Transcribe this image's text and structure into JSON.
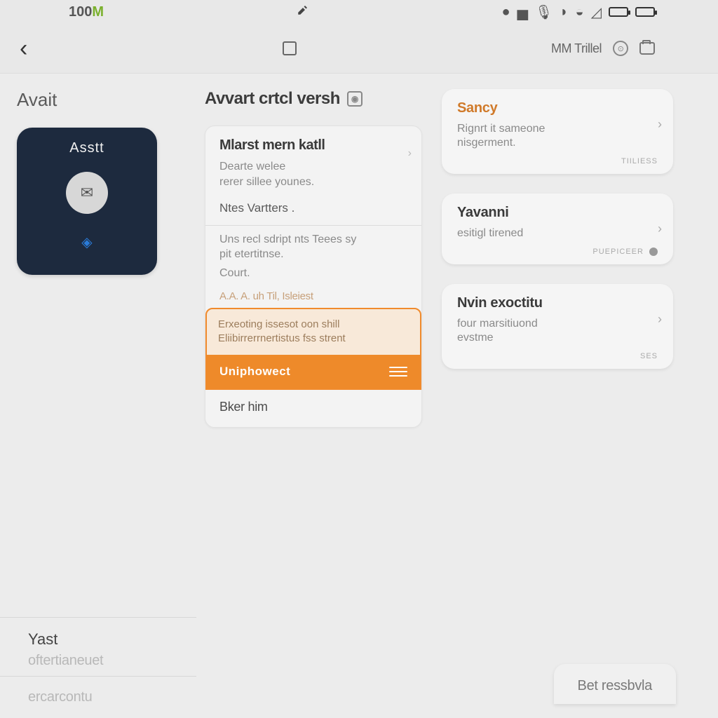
{
  "statusbar": {
    "time_prefix": "100",
    "time_suffix": "M"
  },
  "titlebar": {
    "right_text": "MM Trillel"
  },
  "left": {
    "header": "Avait",
    "card_label": "Asstt"
  },
  "mid": {
    "header": "Avvart crtcl versh",
    "card": {
      "title1": "Mlarst mern katll",
      "line1": "Dearte welee",
      "line2": "rerer sillee younes.",
      "sub1": "Ntes Vartters .",
      "body2a": "Uns recl sdript nts Teees sy",
      "body2b": "pit etertitnse.",
      "body2c": "Court.",
      "faint": "A.A. A. uh Til, Isleiest",
      "hl1": "Erxeoting issesot oon shill",
      "hl2": "Eliibirrerrnertistus fss strent",
      "hl_button": "Uniphowect",
      "footer": "Bker him"
    }
  },
  "right": {
    "cards": [
      {
        "title": "Sancy",
        "body1": "Rignrt it sameone",
        "body2": "nisgerment.",
        "stamp": "TIILIESS"
      },
      {
        "title": "Yavanni",
        "body1": "esitigl tirened",
        "body2": "",
        "stamp": "PUEPICEER"
      },
      {
        "title": "Nvin exoctitu",
        "body1": "four marsitiuond",
        "body2": "evstme",
        "stamp": "SES"
      }
    ]
  },
  "bottom_left": {
    "title": "Yast",
    "sub": "oftertianeuet"
  },
  "bottom_left2": "ercarcontu",
  "bottom_right": "Bet ressbvla"
}
